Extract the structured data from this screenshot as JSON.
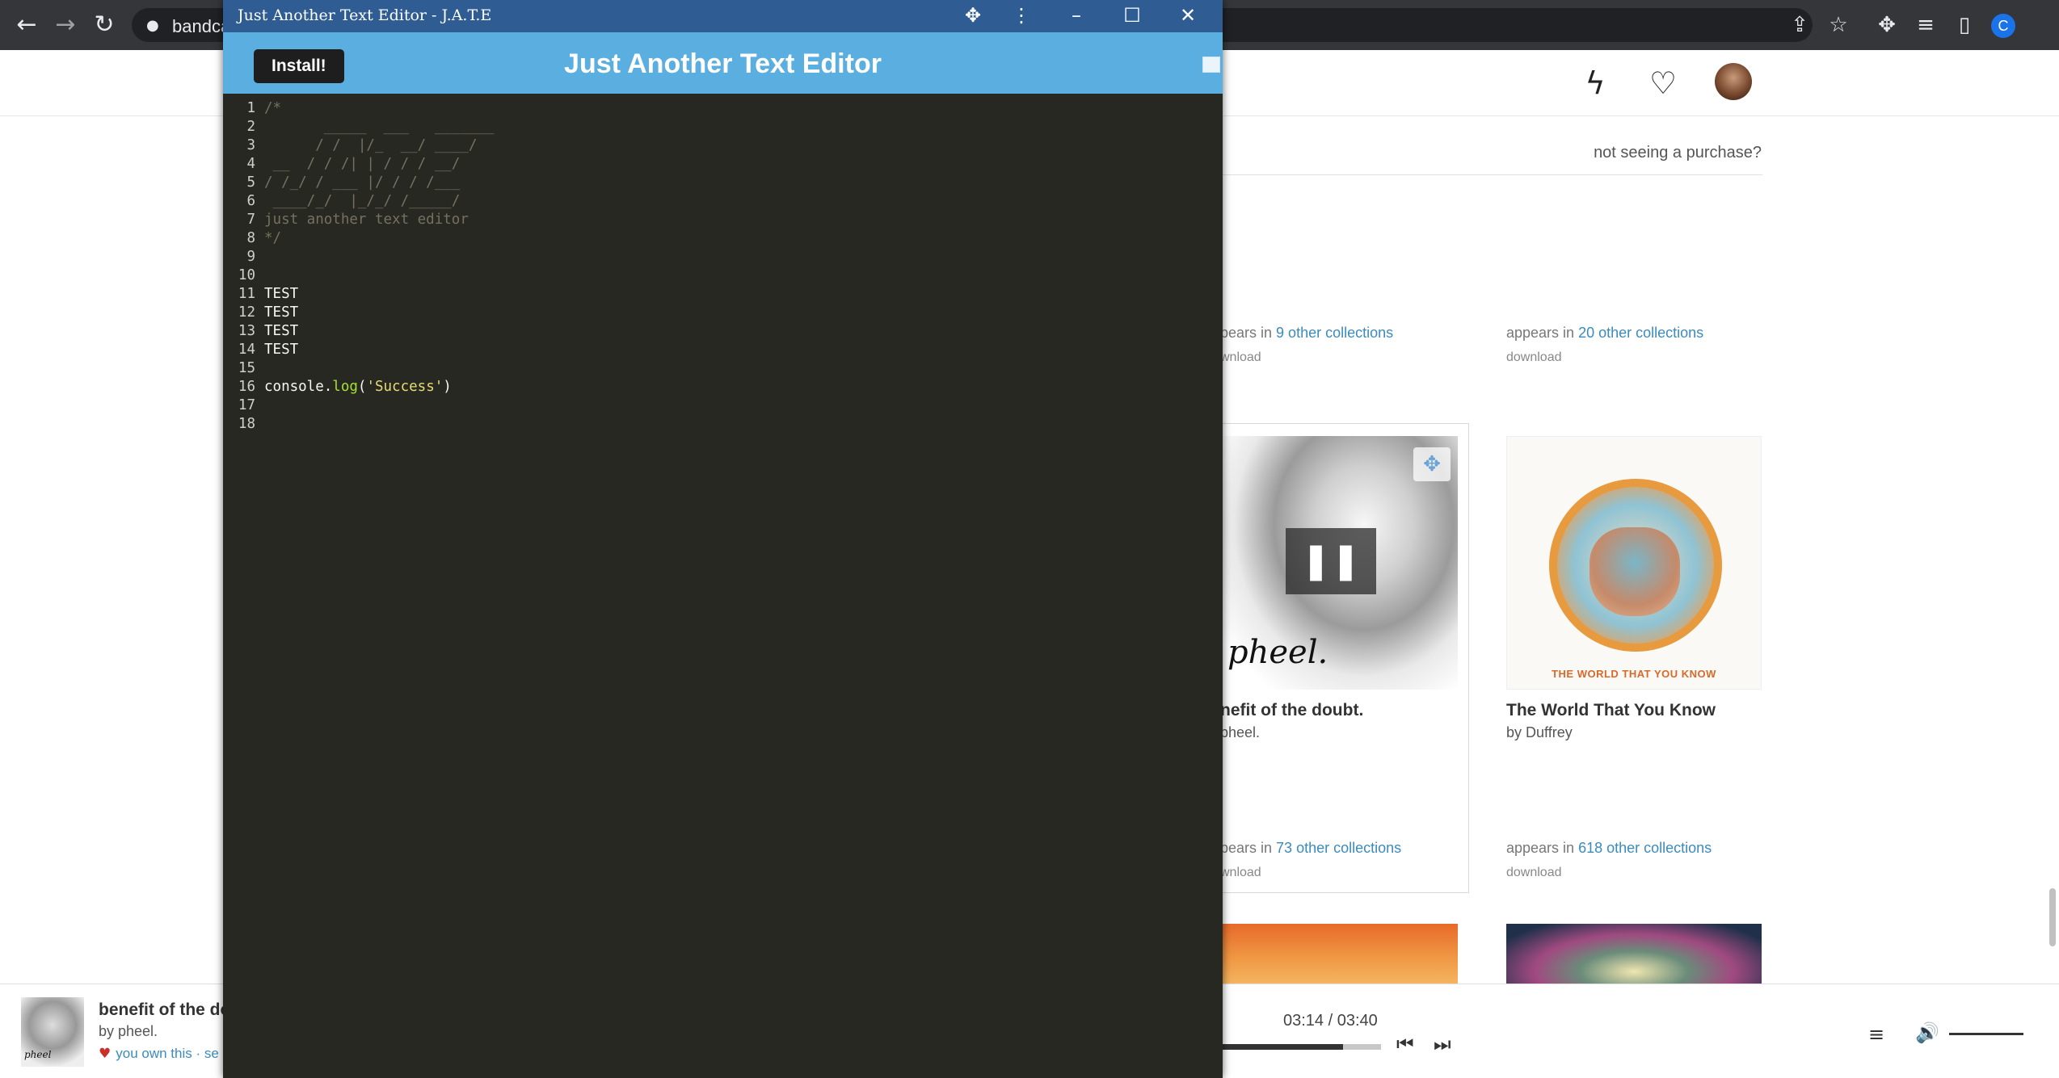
{
  "browser": {
    "url_visible": "bandca",
    "profile_initial": "C",
    "icons": {
      "back": "back-arrow-icon",
      "forward": "forward-arrow-icon",
      "reload": "reload-icon",
      "share": "share-icon",
      "bookmark": "star-icon",
      "extensions": "puzzle-icon",
      "media": "media-queue-icon",
      "sidepanel": "side-panel-icon"
    }
  },
  "bandcamp": {
    "not_seeing": "not seeing a purchase?",
    "cards_top": [
      {
        "appears_prefix": "pears in ",
        "appears_link": "9 other collections",
        "download": "wnload"
      },
      {
        "appears_prefix": "appears in ",
        "appears_link": "20 other collections",
        "download": "download"
      }
    ],
    "cards_mid": [
      {
        "title": "nefit of the doubt.",
        "artist": "pheel.",
        "cover_text": "pheel.",
        "appears_prefix": "pears in ",
        "appears_link": "73 other collections",
        "download": "wnload"
      },
      {
        "title": "The World That You Know",
        "artist": "by Duffrey",
        "cover_text": "THE WORLD THAT YOU KNOW",
        "appears_prefix": "appears in ",
        "appears_link": "618 other collections",
        "download": "download"
      }
    ],
    "player": {
      "title": "benefit of the do",
      "artist": "by pheel.",
      "own_text": "you own this · se",
      "mini_cover_text": "pheel",
      "time": "03:14 / 03:40",
      "progress_fraction": 0.77,
      "volume_fraction": 1.0
    }
  },
  "jate": {
    "window_title": "Just Another Text Editor - J.A.T.E",
    "install_label": "Install!",
    "heading": "Just Another Text Editor",
    "window_controls": [
      "puzzle-icon",
      "kebab-menu-icon",
      "minimize-icon",
      "maximize-icon",
      "close-icon"
    ],
    "lines": [
      {
        "n": "1",
        "type": "comment",
        "text": "/*"
      },
      {
        "n": "2",
        "type": "comment",
        "text": "       _____  ___   _______"
      },
      {
        "n": "3",
        "type": "comment",
        "text": "      / /  |/_  __/ ____/"
      },
      {
        "n": "4",
        "type": "comment",
        "text": " __  / / /| | / / / __/"
      },
      {
        "n": "5",
        "type": "comment",
        "text": "/ /_/ / ___ |/ / / /___"
      },
      {
        "n": "6",
        "type": "comment",
        "text": " ____/_/  |_/_/ /_____/"
      },
      {
        "n": "7",
        "type": "comment",
        "text": "just another text editor"
      },
      {
        "n": "8",
        "type": "comment",
        "text": "*/"
      },
      {
        "n": "9",
        "type": "plain",
        "text": ""
      },
      {
        "n": "10",
        "type": "plain",
        "text": ""
      },
      {
        "n": "11",
        "type": "plain",
        "text": "TEST"
      },
      {
        "n": "12",
        "type": "plain",
        "text": "TEST"
      },
      {
        "n": "13",
        "type": "plain",
        "text": "TEST"
      },
      {
        "n": "14",
        "type": "plain",
        "text": "TEST"
      },
      {
        "n": "15",
        "type": "plain",
        "text": ""
      },
      {
        "n": "16",
        "type": "code",
        "obj": "console.",
        "fn": "log",
        "open": "(",
        "str": "'Success'",
        "close": ")"
      },
      {
        "n": "17",
        "type": "plain",
        "text": ""
      },
      {
        "n": "18",
        "type": "plain",
        "text": ""
      }
    ]
  }
}
